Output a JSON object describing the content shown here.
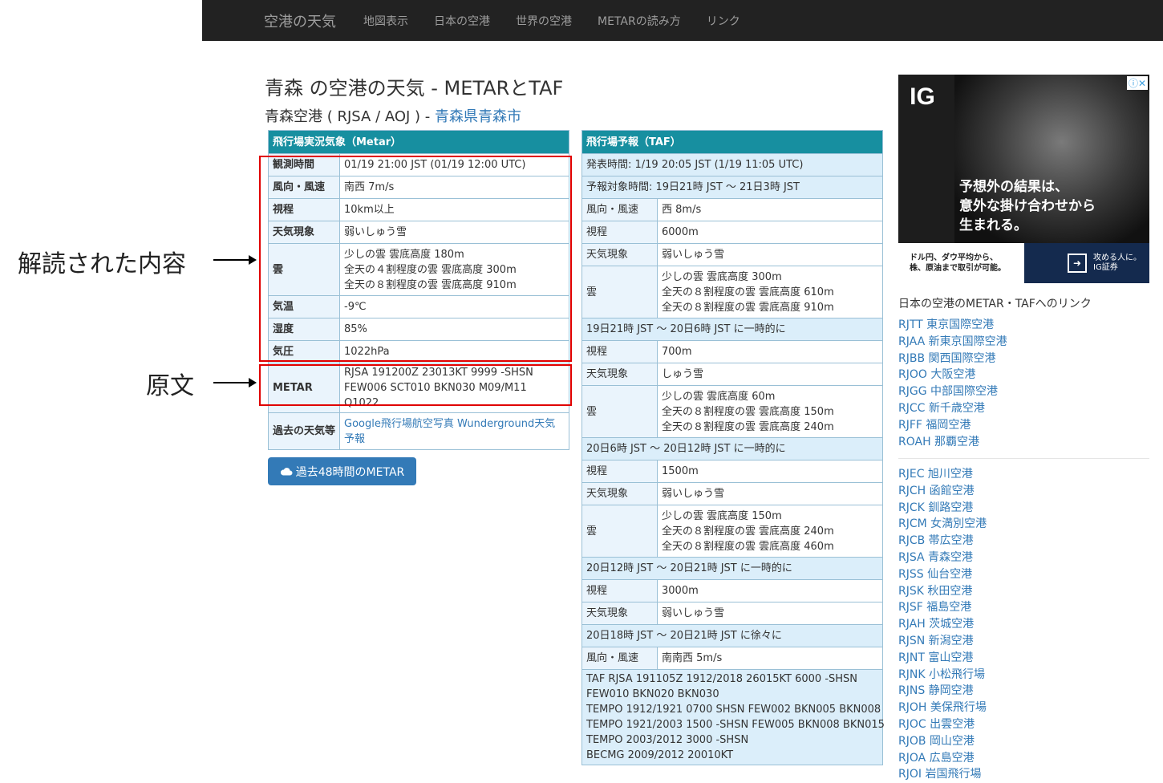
{
  "nav": {
    "brand": "空港の天気",
    "links": [
      "地図表示",
      "日本の空港",
      "世界の空港",
      "METARの読み方",
      "リンク"
    ]
  },
  "page": {
    "title": "青森 の空港の天気 - METARとTAF",
    "subtitle_prefix": "青森空港 ( RJSA / AOJ ) - ",
    "subtitle_link": "青森県青森市"
  },
  "metar": {
    "header": "飛行場実況気象（Metar）",
    "rows": [
      {
        "label": "観測時間",
        "value": "01/19 21:00 JST (01/19 12:00 UTC)"
      },
      {
        "label": "風向・風速",
        "value": "南西 7m/s"
      },
      {
        "label": "視程",
        "value": "10km以上"
      },
      {
        "label": "天気現象",
        "value": "弱いしゅう雪"
      },
      {
        "label": "雲",
        "lines": [
          "少しの雲 雲底高度 180m",
          "全天の４割程度の雲 雲底高度 300m",
          "全天の８割程度の雲 雲底高度 910m"
        ]
      },
      {
        "label": "気温",
        "value": "-9℃"
      },
      {
        "label": "湿度",
        "value": "85%"
      },
      {
        "label": "気圧",
        "value": "1022hPa"
      },
      {
        "label": "METAR",
        "lines": [
          "RJSA 191200Z 23013KT 9999 -SHSN",
          "FEW006 SCT010 BKN030 M09/M11 Q1022"
        ]
      }
    ],
    "past_label": "過去の天気等",
    "past_links": "Google飛行場航空写真 Wunderground天気予報",
    "button": "過去48時間のMETAR"
  },
  "taf": {
    "header": "飛行場予報（TAF）",
    "issued": "発表時間: 1/19 20:05 JST (1/19 11:05 UTC)",
    "valid": "予報対象時間: 19日21時 JST ～ 21日3時 JST",
    "main": [
      {
        "label": "風向・風速",
        "value": "西 8m/s"
      },
      {
        "label": "視程",
        "value": "6000m"
      },
      {
        "label": "天気現象",
        "value": "弱いしゅう雪"
      },
      {
        "label": "雲",
        "lines": [
          "少しの雲 雲底高度 300m",
          "全天の８割程度の雲 雲底高度 610m",
          "全天の８割程度の雲 雲底高度 910m"
        ]
      }
    ],
    "groups": [
      {
        "title": "19日21時 JST ～ 20日6時 JST に一時的に",
        "rows": [
          {
            "label": "視程",
            "value": "700m"
          },
          {
            "label": "天気現象",
            "value": "しゅう雪"
          },
          {
            "label": "雲",
            "lines": [
              "少しの雲 雲底高度 60m",
              "全天の８割程度の雲 雲底高度 150m",
              "全天の８割程度の雲 雲底高度 240m"
            ]
          }
        ]
      },
      {
        "title": "20日6時 JST ～ 20日12時 JST に一時的に",
        "rows": [
          {
            "label": "視程",
            "value": "1500m"
          },
          {
            "label": "天気現象",
            "value": "弱いしゅう雪"
          },
          {
            "label": "雲",
            "lines": [
              "少しの雲 雲底高度 150m",
              "全天の８割程度の雲 雲底高度 240m",
              "全天の８割程度の雲 雲底高度 460m"
            ]
          }
        ]
      },
      {
        "title": "20日12時 JST ～ 20日21時 JST に一時的に",
        "rows": [
          {
            "label": "視程",
            "value": "3000m"
          },
          {
            "label": "天気現象",
            "value": "弱いしゅう雪"
          }
        ]
      },
      {
        "title": "20日18時 JST ～ 20日21時 JST に徐々に",
        "rows": [
          {
            "label": "風向・風速",
            "value": "南南西 5m/s"
          }
        ]
      }
    ],
    "raw_lines": [
      "TAF RJSA 191105Z 1912/2018 26015KT 6000 -SHSN",
      "FEW010 BKN020 BKN030",
      "TEMPO 1912/1921 0700 SHSN FEW002 BKN005 BKN008",
      "TEMPO 1921/2003 1500 -SHSN FEW005 BKN008 BKN015",
      "TEMPO 2003/2012 3000 -SHSN",
      "BECMG 2009/2012 20010KT"
    ]
  },
  "annotations": {
    "decoded": "解読された内容",
    "raw": "原文"
  },
  "ad": {
    "logo": "IG",
    "copy_lines": [
      "予想外の結果は、",
      "意外な掛け合わせから",
      "生まれる。"
    ],
    "small_lines": [
      "ドル円、ダウ平均から、",
      "株、原油まで取引が可能。"
    ],
    "cta_lines": [
      "攻める人に。",
      "IG証券"
    ]
  },
  "sidebar": {
    "title": "日本の空港のMETAR・TAFへのリンク",
    "major": [
      "RJTT 東京国際空港",
      "RJAA 新東京国際空港",
      "RJBB 関西国際空港",
      "RJOO 大阪空港",
      "RJGG 中部国際空港",
      "RJCC 新千歳空港",
      "RJFF 福岡空港",
      "ROAH 那覇空港"
    ],
    "others": [
      "RJEC 旭川空港",
      "RJCH 函館空港",
      "RJCK 釧路空港",
      "RJCM 女満別空港",
      "RJCB 帯広空港",
      "RJSA 青森空港",
      "RJSS 仙台空港",
      "RJSK 秋田空港",
      "RJSF 福島空港",
      "RJAH 茨城空港",
      "RJSN 新潟空港",
      "RJNT 富山空港",
      "RJNK 小松飛行場",
      "RJNS 静岡空港",
      "RJOH 美保飛行場",
      "RJOC 出雲空港",
      "RJOB 岡山空港",
      "RJOA 広島空港",
      "RJOI 岩国飛行場"
    ]
  }
}
